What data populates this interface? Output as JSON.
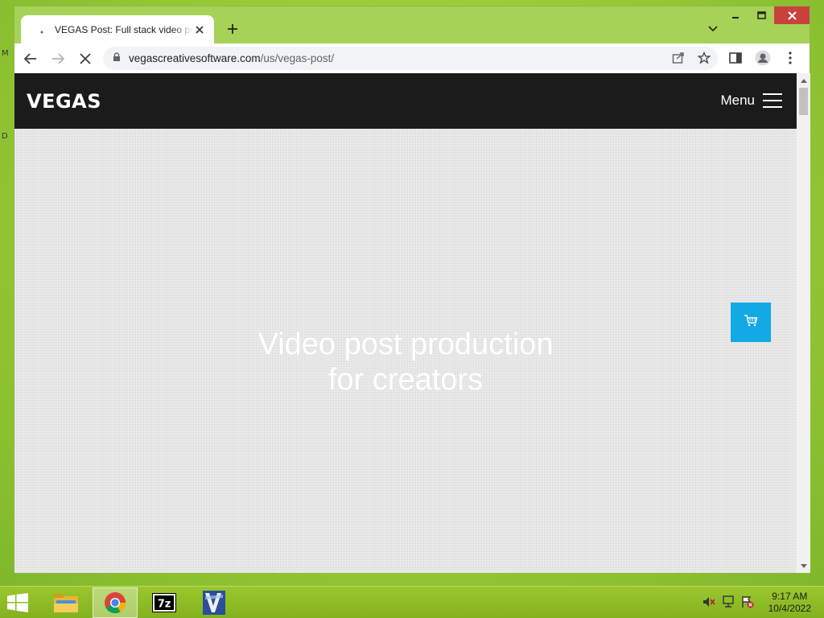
{
  "desktop": {
    "glyphs": [
      "M",
      "D"
    ]
  },
  "browser": {
    "tab": {
      "title": "VEGAS Post: Full stack video production",
      "favicon": "loading-icon"
    },
    "new_tab_label": "+",
    "window_controls": {
      "minimize": "minimize-icon",
      "maximize": "maximize-icon",
      "close": "close-icon"
    },
    "address": {
      "domain": "vegascreativesoftware.com",
      "path": "/us/vegas-post/"
    }
  },
  "site": {
    "logo": "VEGAS",
    "menu_label": "Menu",
    "hero_line1": "Video post production",
    "hero_line2": "for creators",
    "cart_icon": "shopping-cart-icon"
  },
  "taskbar": {
    "time": "9:17 AM",
    "date": "10/4/2022",
    "apps": [
      "file-explorer",
      "chrome",
      "7-zip",
      "vegas"
    ]
  },
  "colors": {
    "accent": "#13a9e4",
    "header_bg": "#1b1b1c",
    "desktop": "#a4cf3e"
  }
}
